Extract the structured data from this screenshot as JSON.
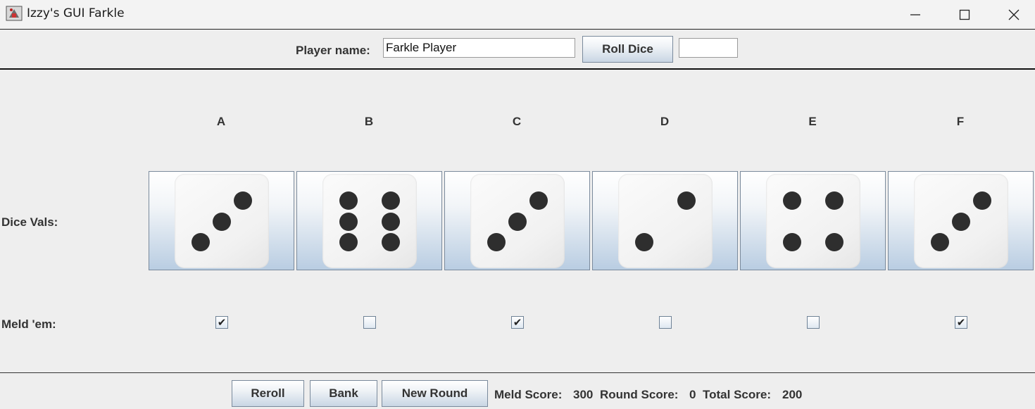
{
  "window": {
    "title": "Izzy's GUI Farkle",
    "controls": [
      "minimize-icon",
      "maximize-icon",
      "close-icon"
    ]
  },
  "top": {
    "player_label": "Player name:",
    "player_name": "Farkle Player",
    "roll_button": "Roll Dice",
    "roll_result": ""
  },
  "dice": {
    "row_label": "Dice Vals:",
    "meld_label": "Meld 'em:",
    "columns": [
      {
        "label": "A",
        "value": 3,
        "meld": true
      },
      {
        "label": "B",
        "value": 6,
        "meld": false
      },
      {
        "label": "C",
        "value": 3,
        "meld": true
      },
      {
        "label": "D",
        "value": 2,
        "meld": false
      },
      {
        "label": "E",
        "value": 4,
        "meld": false
      },
      {
        "label": "F",
        "value": 3,
        "meld": true
      }
    ]
  },
  "bottom": {
    "reroll_button": "Reroll",
    "bank_button": "Bank",
    "new_round_button": "New Round",
    "meld_score_label": "Meld Score:",
    "meld_score": "300",
    "round_score_label": "Round Score:",
    "round_score": "0",
    "total_score_label": "Total Score:",
    "total_score": "200"
  }
}
